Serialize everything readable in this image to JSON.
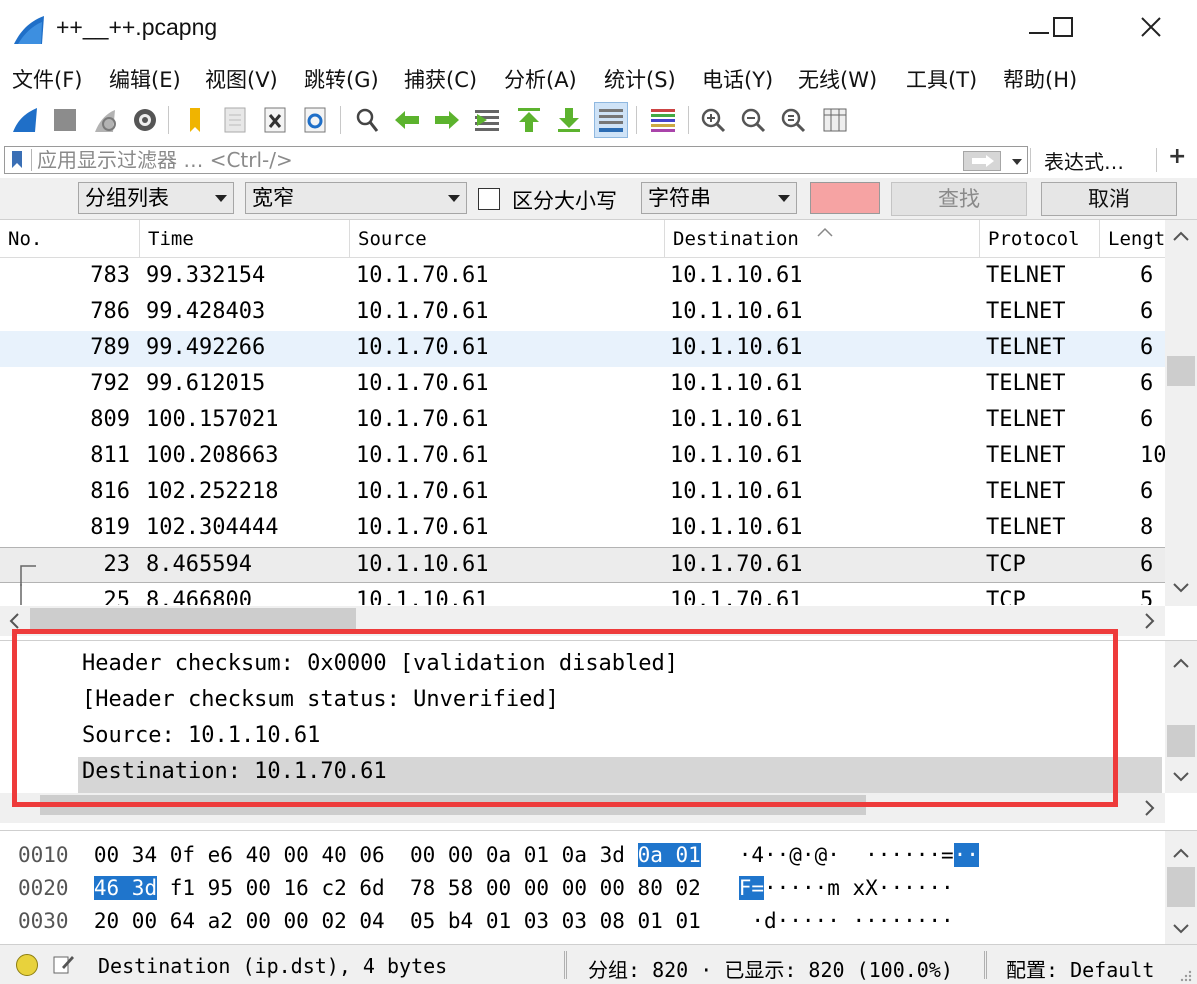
{
  "window": {
    "title": "++__++.pcapng"
  },
  "menu": [
    "文件(F)",
    "编辑(E)",
    "视图(V)",
    "跳转(G)",
    "捕获(C)",
    "分析(A)",
    "统计(S)",
    "电话(Y)",
    "无线(W)",
    "工具(T)",
    "帮助(H)"
  ],
  "toolbar": {
    "icons": [
      "start-capture-icon",
      "stop-capture-icon",
      "restart-capture-icon",
      "capture-options-icon",
      "open-file-icon",
      "save-file-icon",
      "close-file-icon",
      "reload-file-icon",
      "find-packet-icon",
      "go-back-icon",
      "go-forward-icon",
      "go-to-packet-icon",
      "go-first-icon",
      "go-last-icon",
      "autoscroll-icon",
      "colorize-icon",
      "zoom-in-icon",
      "zoom-out-icon",
      "zoom-normal-icon",
      "resize-columns-icon"
    ]
  },
  "filter": {
    "placeholder": "应用显示过滤器 … <Ctrl-/>",
    "expression_label": "表达式…",
    "plus": "+"
  },
  "find": {
    "search_in": "分组列表",
    "char_width": "宽窄",
    "case_label": "区分大小写",
    "search_type": "字符串",
    "find_label": "查找",
    "cancel_label": "取消"
  },
  "packet_list": {
    "columns": [
      "No.",
      "Time",
      "Source",
      "Destination",
      "Protocol",
      "Lengt"
    ],
    "rows": [
      {
        "no": "783",
        "time": "99.332154",
        "source": "10.1.70.61",
        "destination": "10.1.10.61",
        "protocol": "TELNET",
        "length": "6"
      },
      {
        "no": "786",
        "time": "99.428403",
        "source": "10.1.70.61",
        "destination": "10.1.10.61",
        "protocol": "TELNET",
        "length": "6"
      },
      {
        "no": "789",
        "time": "99.492266",
        "source": "10.1.70.61",
        "destination": "10.1.10.61",
        "protocol": "TELNET",
        "length": "6"
      },
      {
        "no": "792",
        "time": "99.612015",
        "source": "10.1.70.61",
        "destination": "10.1.10.61",
        "protocol": "TELNET",
        "length": "6"
      },
      {
        "no": "809",
        "time": "100.157021",
        "source": "10.1.70.61",
        "destination": "10.1.10.61",
        "protocol": "TELNET",
        "length": "6"
      },
      {
        "no": "811",
        "time": "100.208663",
        "source": "10.1.70.61",
        "destination": "10.1.10.61",
        "protocol": "TELNET",
        "length": "10"
      },
      {
        "no": "816",
        "time": "102.252218",
        "source": "10.1.70.61",
        "destination": "10.1.10.61",
        "protocol": "TELNET",
        "length": "6"
      },
      {
        "no": "819",
        "time": "102.304444",
        "source": "10.1.70.61",
        "destination": "10.1.10.61",
        "protocol": "TELNET",
        "length": "8"
      },
      {
        "no": "23",
        "time": "8.465594",
        "source": "10.1.10.61",
        "destination": "10.1.70.61",
        "protocol": "TCP",
        "length": "6"
      },
      {
        "no": "25",
        "time": "8.466800",
        "source": "10.1.10.61",
        "destination": "10.1.70.61",
        "protocol": "TCP",
        "length": "5"
      }
    ]
  },
  "details": {
    "lines": [
      "Header checksum: 0x0000 [validation disabled]",
      "[Header checksum status: Unverified]",
      "Source: 10.1.10.61",
      "Destination: 10.1.70.61"
    ]
  },
  "hex": {
    "rows": [
      {
        "offset": "0010",
        "b1": "00 34 0f e6 40 00 40 06",
        "b2a": "00 00 0a 01 0a 3d",
        "b2h": "0a 01",
        "ascii": "·4··@·@·  ······=",
        "ascii_h": "··"
      },
      {
        "offset": "0020",
        "b1h": "46 3d",
        "b1": "f1 95 00 16 c2 6d",
        "b2": "78 58 00 00 00 00 80 02",
        "ascii_h": "F=",
        "ascii": "·····m xX······"
      },
      {
        "offset": "0030",
        "b1": "20 00 64 a2 00 00 02 04",
        "b2": "05 b4 01 03 03 08 01 01",
        "ascii": " ·d····· ········"
      }
    ]
  },
  "status": {
    "field": "Destination (ip.dst), 4 bytes",
    "packets": "分组: 820 · 已显示: 820 (100.0%)",
    "profile": "配置: Default"
  },
  "colors": {
    "selection_highlight": "#1f75cc",
    "annotation_box": "#ee3b3b",
    "find_input_error": "#f6a3a3",
    "status_led": "#e8d23c"
  }
}
